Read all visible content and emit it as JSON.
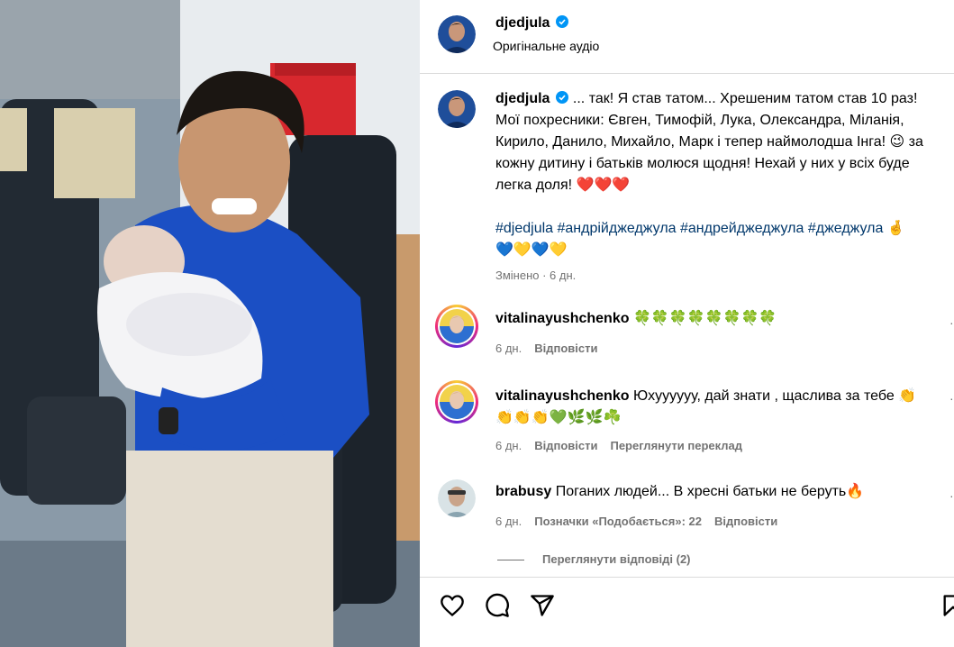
{
  "post": {
    "author": "djedjula",
    "audio": "Оригінальне аудіо",
    "caption": "... так! Я став татом... Хрешеним татом став 10 раз! Мої похресники: Євген, Тимофій, Лука, Олександра, Міланія, Кирило, Данило, Михайло, Марк і тепер наймолодша Інга! 😉 за кожну дитину і батьків молюся щодня! Нехай у них у всіх буде легка доля! ❤️❤️❤️",
    "hashtags": "#djedjula #андрійджеджула #андрейджеджула #джеджула 🤞",
    "hearts": "💙💛💙💛",
    "edited": "Змінено · 6 дн."
  },
  "comments": [
    {
      "user": "vitalinayushchenko",
      "text": "🍀🍀🍀🍀🍀🍀🍀🍀",
      "time": "6 дн.",
      "reply": "Відповісти",
      "extra": ""
    },
    {
      "user": "vitalinayushchenko",
      "text": "Юхууууyу, дай знати , щаслива за тебе 👏👏👏👏💚🌿🌿☘️",
      "time": "6 дн.",
      "reply": "Відповісти",
      "extra": "Переглянути переклад"
    },
    {
      "user": "brabusy",
      "text": "Поганих людей... В хресні батьки не беруть🔥",
      "time": "6 дн.",
      "likes": "Позначки «Подобається»: 22",
      "reply": "Відповісти",
      "extra": ""
    }
  ],
  "view_replies": "Переглянути відповіді (2)",
  "icons": [
    "heart-icon",
    "comment-icon",
    "share-icon",
    "bookmark-icon",
    "more-icon",
    "verified-icon"
  ],
  "colors": {
    "link": "#00376b",
    "muted": "#737373",
    "verified": "#0095f6",
    "divider": "#dbdbdb"
  }
}
